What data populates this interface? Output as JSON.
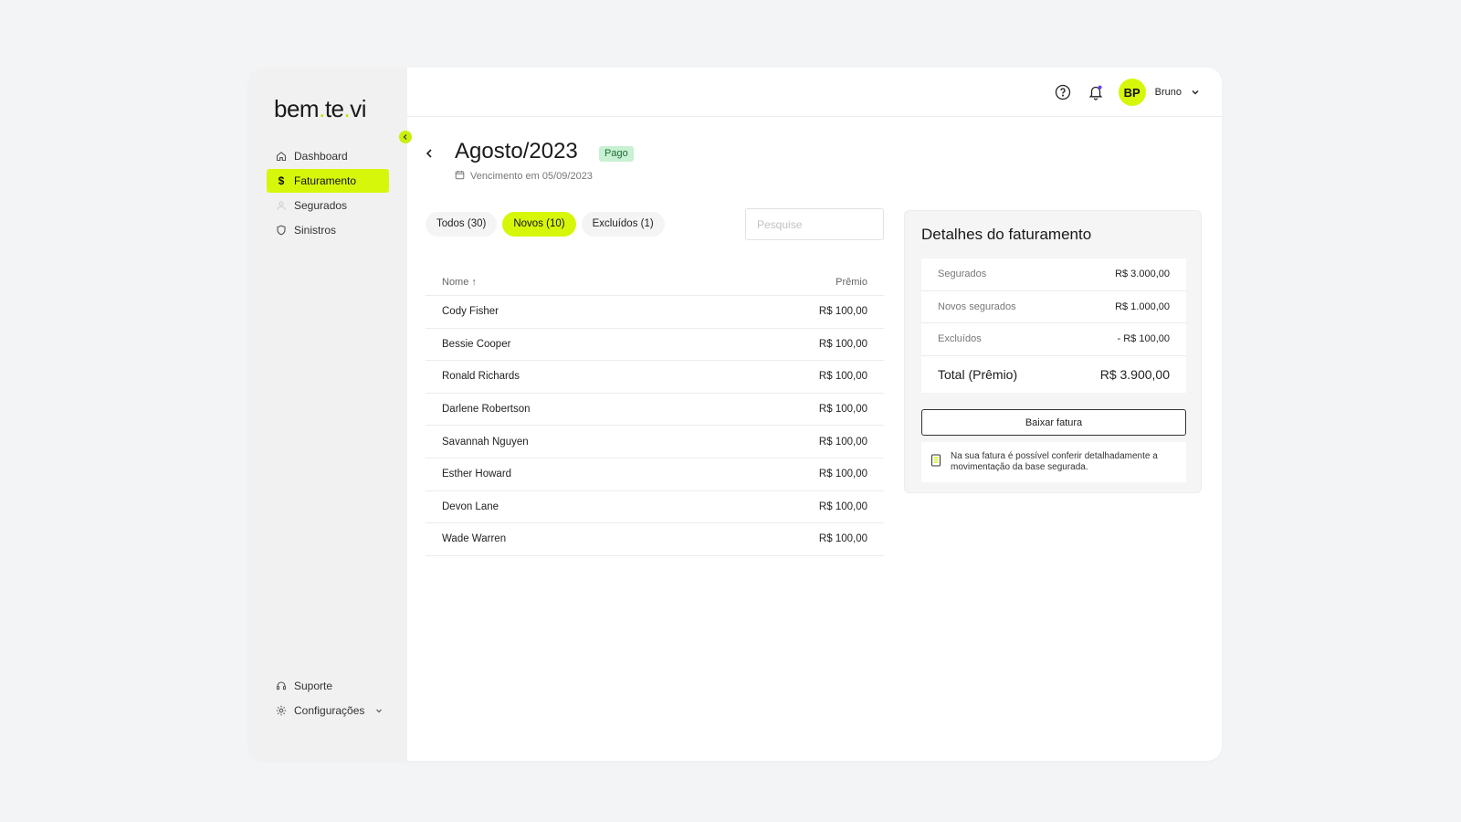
{
  "brand": {
    "logo_part1": "bem",
    "logo_dot1": ".",
    "logo_part2": "te",
    "logo_dot2": ".",
    "logo_part3": "vi",
    "accent": "#d6f70a"
  },
  "sidebar": {
    "items": [
      {
        "label": "Dashboard",
        "icon": "home-icon"
      },
      {
        "label": "Faturamento",
        "icon": "dollar-icon"
      },
      {
        "label": "Segurados",
        "icon": "users-icon"
      },
      {
        "label": "Sinistros",
        "icon": "shield-icon"
      }
    ],
    "bottom": [
      {
        "label": "Suporte",
        "icon": "headset-icon"
      },
      {
        "label": "Configurações",
        "icon": "gear-icon"
      }
    ]
  },
  "header": {
    "avatar_initials": "BP",
    "user_name": "Bruno"
  },
  "page": {
    "title": "Agosto/2023",
    "status": "Pago",
    "due": "Vencimento em 05/09/2023"
  },
  "tabs": [
    {
      "label": "Todos (30)"
    },
    {
      "label": "Novos (10)"
    },
    {
      "label": "Excluídos (1)"
    }
  ],
  "search": {
    "placeholder": "Pesquise"
  },
  "table": {
    "col_name": "Nome ↑",
    "col_premium": "Prêmio",
    "rows": [
      {
        "name": "Cody Fisher",
        "premium": "R$ 100,00"
      },
      {
        "name": "Bessie Cooper",
        "premium": "R$ 100,00"
      },
      {
        "name": "Ronald Richards",
        "premium": "R$ 100,00"
      },
      {
        "name": "Darlene Robertson",
        "premium": "R$ 100,00"
      },
      {
        "name": "Savannah Nguyen",
        "premium": "R$ 100,00"
      },
      {
        "name": "Esther Howard",
        "premium": "R$ 100,00"
      },
      {
        "name": "Devon Lane",
        "premium": "R$ 100,00"
      },
      {
        "name": "Wade Warren",
        "premium": "R$ 100,00"
      }
    ]
  },
  "details": {
    "title": "Detalhes do faturamento",
    "rows": [
      {
        "label": "Segurados",
        "value": "R$ 3.000,00"
      },
      {
        "label": "Novos segurados",
        "value": "R$ 1.000,00"
      },
      {
        "label": "Excluídos",
        "value": "- R$ 100,00"
      }
    ],
    "total_label": "Total (Prêmio)",
    "total_value": "R$ 3.900,00",
    "download_label": "Baixar fatura",
    "note": "Na sua fatura é possível conferir detalhadamente a movimentação da base segurada."
  }
}
